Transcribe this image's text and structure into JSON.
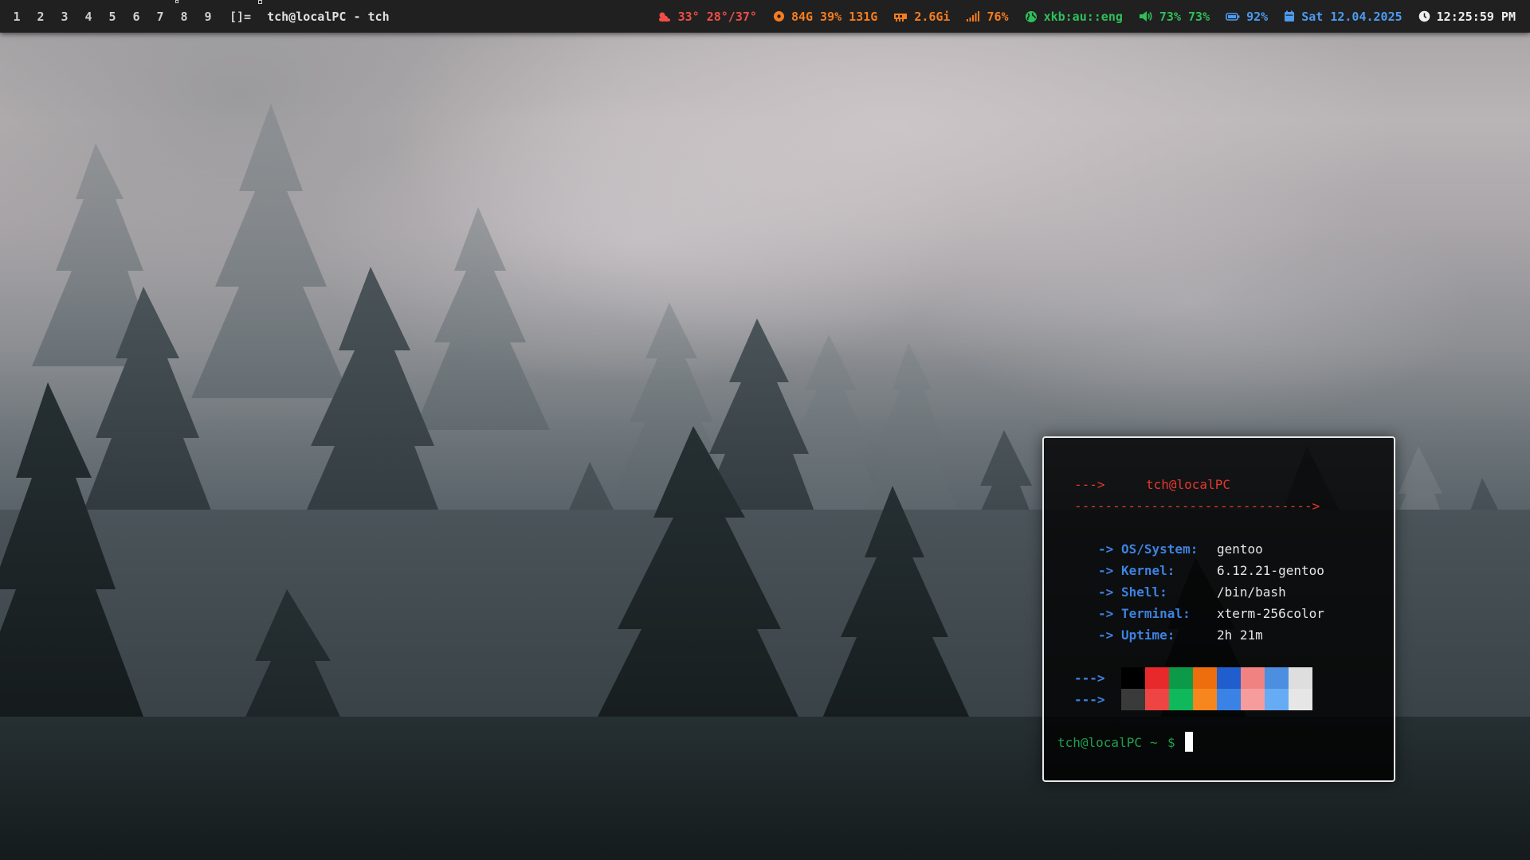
{
  "bar": {
    "tags": [
      "1",
      "2",
      "3",
      "4",
      "5",
      "6",
      "7",
      "8",
      "9"
    ],
    "layout_symbol": "[]=",
    "window_title": "tch@localPC - tch",
    "weather": {
      "icon": "cloud-sun-icon",
      "text": "33° 28°/37°",
      "color": "#f04d48"
    },
    "disk": {
      "icon": "disk-icon",
      "text": "84G 39% 131G",
      "color": "#f57d1f"
    },
    "memory": {
      "icon": "memory-icon",
      "text": "2.6Gi",
      "color": "#f57d1f"
    },
    "cpu": {
      "icon": "signal-bars-icon",
      "text": "76%",
      "color": "#f57d1f"
    },
    "keyboard": {
      "icon": "globe-icon",
      "text": "xkb:au::eng",
      "color": "#2fbf5a"
    },
    "volume": {
      "icon": "speaker-icon",
      "text": "73% 73%",
      "color": "#2fbf5a"
    },
    "battery": {
      "icon": "battery-icon",
      "text": "92%",
      "color": "#4d9bef"
    },
    "date": {
      "icon": "calendar-icon",
      "text": "Sat 12.04.2025",
      "color": "#4d9bef"
    },
    "time": {
      "icon": "clock-icon",
      "text": "12:25:59 PM",
      "color": "#efefef"
    }
  },
  "terminal": {
    "header_arrow": "--->",
    "user_host": "tch@localPC",
    "separator": "------------------------------->",
    "info": [
      {
        "arrow": "->",
        "label": "OS/System:",
        "value": "gentoo"
      },
      {
        "arrow": "->",
        "label": "Kernel:",
        "value": "6.12.21-gentoo"
      },
      {
        "arrow": "->",
        "label": "Shell:",
        "value": "/bin/bash"
      },
      {
        "arrow": "->",
        "label": "Terminal:",
        "value": "xterm-256color"
      },
      {
        "arrow": "->",
        "label": "Uptime:",
        "value": "2h 21m"
      }
    ],
    "palette_arrow": "--->",
    "palette_normal": [
      "#000000",
      "#e8292b",
      "#0d9a48",
      "#ee6e0d",
      "#1f5ecc",
      "#f08282",
      "#4c8fe0",
      "#dedede"
    ],
    "palette_bright": [
      "#3a3a3a",
      "#ee4444",
      "#0fb85a",
      "#f7861f",
      "#3b82e6",
      "#f79c9c",
      "#67abf5",
      "#e6e6e6"
    ],
    "prompt_user": "tch@localPC",
    "prompt_path": "~",
    "prompt_symbol": "$"
  }
}
